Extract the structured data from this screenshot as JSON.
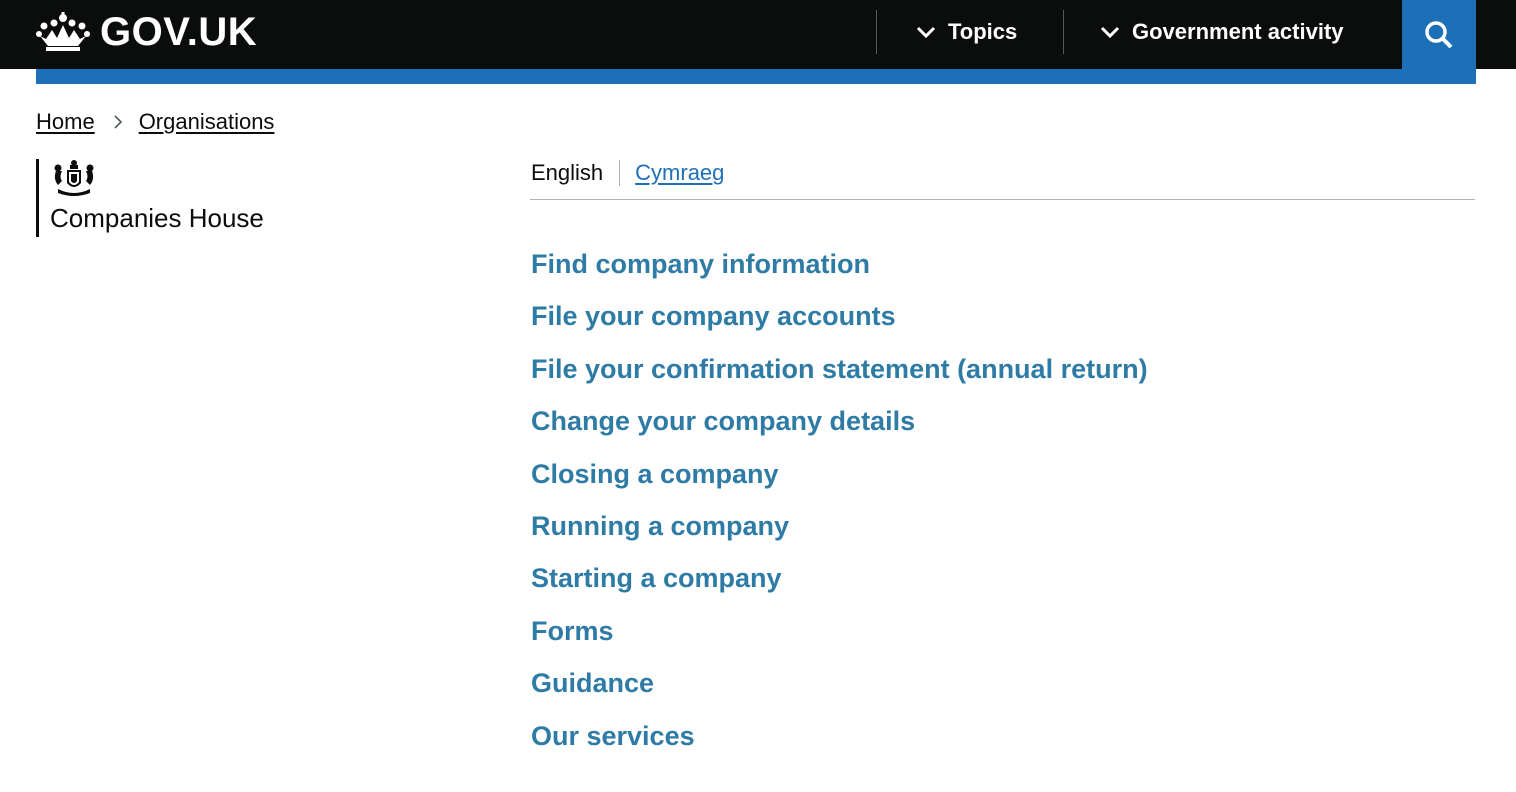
{
  "header": {
    "logo_text": "GOV.UK",
    "nav": [
      {
        "label": "Topics",
        "icon": "chevron-down-icon"
      },
      {
        "label": "Government activity",
        "icon": "chevron-down-icon"
      }
    ],
    "search_icon": "search-icon",
    "colors": {
      "background": "#0b0c0c",
      "accent": "#1d70b8"
    }
  },
  "breadcrumb": [
    {
      "label": "Home"
    },
    {
      "label": "Organisations"
    }
  ],
  "organisation": {
    "name": "Companies House",
    "crest_icon": "royal-arms-icon"
  },
  "language": {
    "current": "English",
    "alternate": "Cymraeg"
  },
  "links": [
    "Find company information",
    "File your company accounts",
    "File your confirmation statement (annual return)",
    "Change your company details",
    "Closing a company",
    "Running a company",
    "Starting a company",
    "Forms",
    "Guidance",
    "Our services"
  ],
  "colors": {
    "link": "#2e7ba6",
    "text": "#0b0c0c"
  }
}
